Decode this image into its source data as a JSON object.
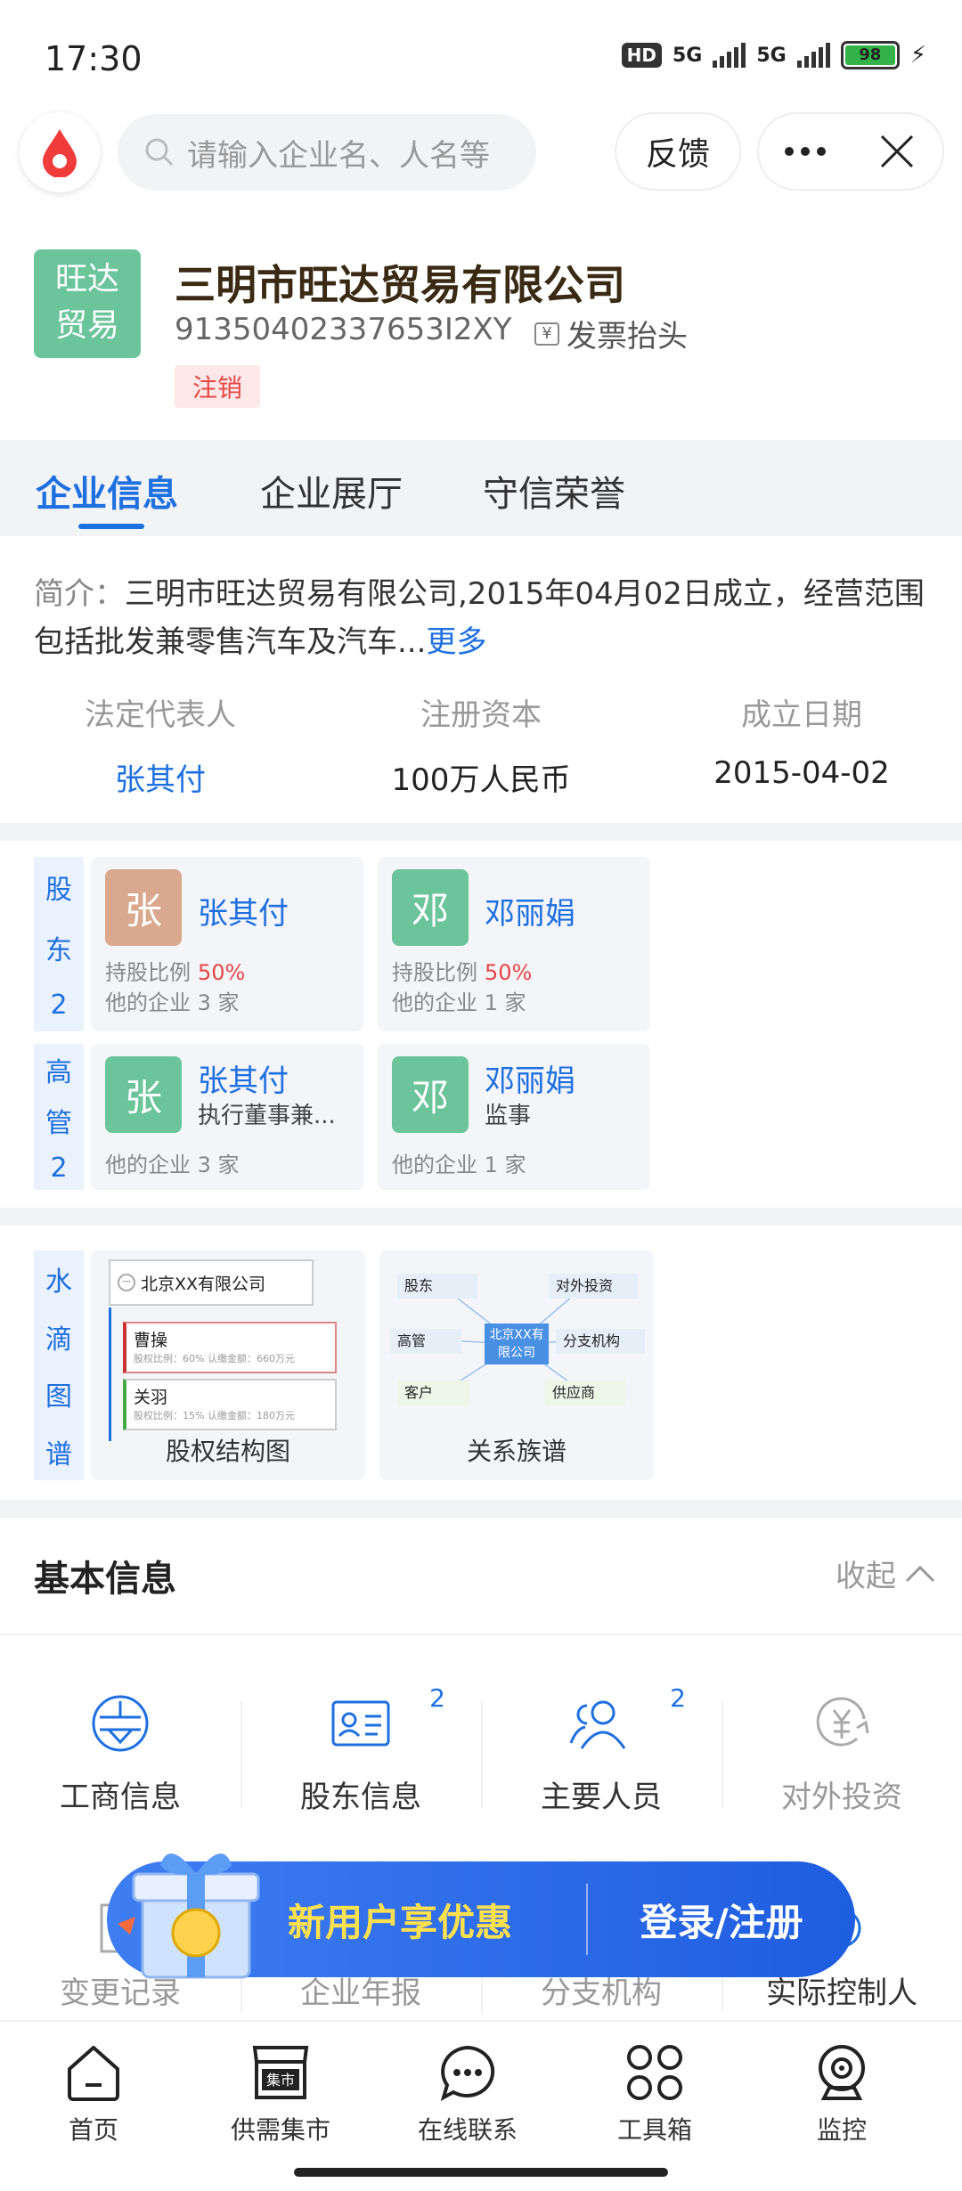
{
  "status_bar": {
    "time": "17:30",
    "hd": "HD",
    "net1": "5G",
    "net2": "5G",
    "battery": "98"
  },
  "top_bar": {
    "search_placeholder": "请输入企业名、人名等",
    "feedback_label": "反馈"
  },
  "company": {
    "logo_line1": "旺达",
    "logo_line2": "贸易",
    "name": "三明市旺达贸易有限公司",
    "credit_code": "91350402337653I2XY",
    "invoice_label": "发票抬头",
    "status": "注销"
  },
  "tabs": [
    "企业信息",
    "企业展厅",
    "守信荣誉"
  ],
  "intro": {
    "label": "简介：",
    "text": "三明市旺达贸易有限公司,2015年04月02日成立，经营范围包括批发兼零售汽车及汽车...",
    "more": "更多"
  },
  "stats": [
    {
      "key": "法定代表人",
      "value": "张其付"
    },
    {
      "key": "注册资本",
      "value": "100万人民币"
    },
    {
      "key": "成立日期",
      "value": "2015-04-02"
    }
  ],
  "shareholders": {
    "label_chars": [
      "股",
      "东",
      "2"
    ],
    "items": [
      {
        "avatar": "张",
        "name": "张其付",
        "ratio_label": "持股比例",
        "ratio": "50%",
        "companies": "他的企业 3 家"
      },
      {
        "avatar": "邓",
        "name": "邓丽娟",
        "ratio_label": "持股比例",
        "ratio": "50%",
        "companies": "他的企业 1 家"
      }
    ]
  },
  "executives": {
    "label_chars": [
      "高",
      "管",
      "2"
    ],
    "items": [
      {
        "avatar": "张",
        "name": "张其付",
        "role": "执行董事兼...",
        "companies": "他的企业 3 家"
      },
      {
        "avatar": "邓",
        "name": "邓丽娟",
        "role": "监事",
        "companies": "他的企业 1 家"
      }
    ]
  },
  "graph": {
    "label_chars": [
      "水",
      "滴",
      "图",
      "谱"
    ],
    "equity": {
      "caption": "股权结构图",
      "root": "北京XX有限公司",
      "rows": [
        {
          "name": "曹操",
          "line": "股权比例：60%  认缴金额：660万元"
        },
        {
          "name": "关羽",
          "line": "股权比例：15%  认缴金额：180万元"
        }
      ]
    },
    "relation": {
      "caption": "关系族谱",
      "center": "北京XX有限公司",
      "nodes": [
        "股东",
        "对外投资",
        "高管",
        "分支机构",
        "客户",
        "供应商"
      ]
    }
  },
  "basic_info": {
    "title": "基本信息",
    "collapse": "收起",
    "row1": [
      {
        "label": "工商信息",
        "count": ""
      },
      {
        "label": "股东信息",
        "count": "2"
      },
      {
        "label": "主要人员",
        "count": "2"
      },
      {
        "label": "对外投资",
        "count": ""
      }
    ],
    "row2": [
      {
        "label": "变更记录"
      },
      {
        "label": "企业年报"
      },
      {
        "label": "分支机构"
      },
      {
        "label": "实际控制人"
      }
    ]
  },
  "promo": {
    "left": "新用户享优惠",
    "right": "登录/注册"
  },
  "bottom_nav": [
    "首页",
    "供需集市",
    "在线联系",
    "工具箱",
    "监控"
  ],
  "market_badge": "集市"
}
